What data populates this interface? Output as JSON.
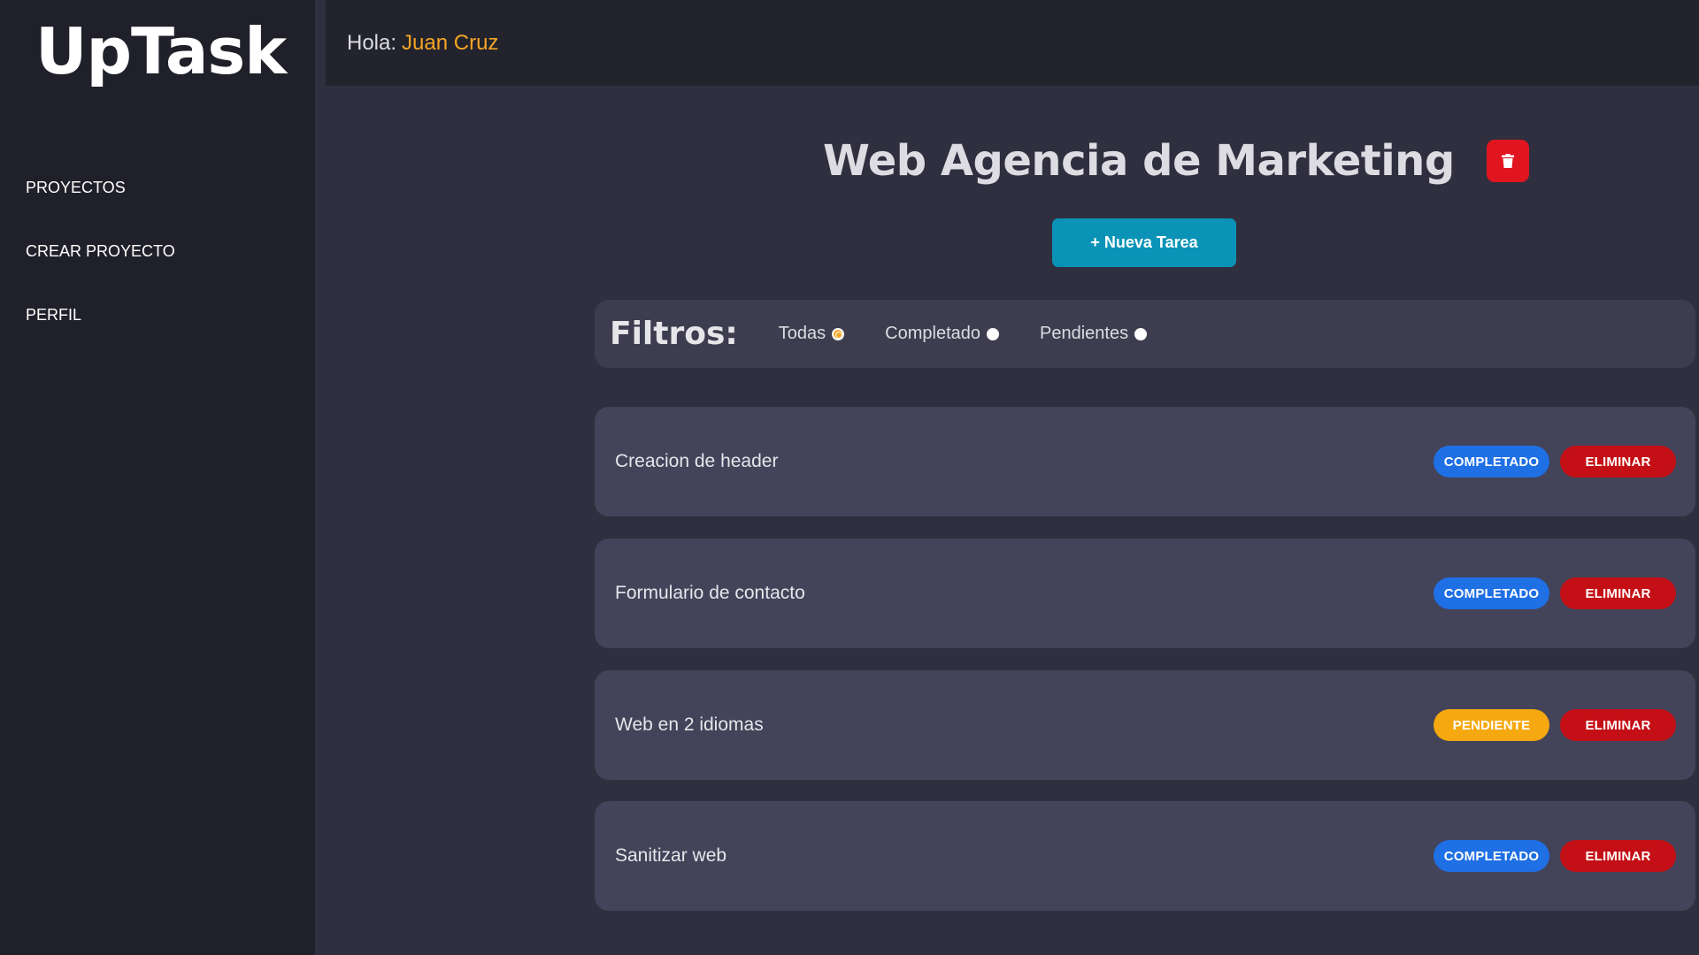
{
  "app": {
    "logo": "UpTask"
  },
  "sidebar": {
    "items": [
      {
        "label": "PROYECTOS"
      },
      {
        "label": "CREAR PROYECTO"
      },
      {
        "label": "PERFIL"
      }
    ]
  },
  "topbar": {
    "greeting": "Hola:",
    "user_name": "Juan Cruz"
  },
  "project": {
    "title": "Web Agencia de Marketing",
    "delete_icon": "trash-icon",
    "new_task_label": "+ Nueva Tarea"
  },
  "filters": {
    "title": "Filtros:",
    "options": [
      {
        "label": "Todas",
        "checked": true
      },
      {
        "label": "Completado",
        "checked": false
      },
      {
        "label": "Pendientes",
        "checked": false
      }
    ]
  },
  "tasks": [
    {
      "name": "Creacion de header",
      "status": "COMPLETADO",
      "delete": "ELIMINAR"
    },
    {
      "name": "Formulario de contacto",
      "status": "COMPLETADO",
      "delete": "ELIMINAR"
    },
    {
      "name": "Web en 2 idiomas",
      "status": "PENDIENTE",
      "delete": "ELIMINAR"
    },
    {
      "name": "Sanitizar web",
      "status": "COMPLETADO",
      "delete": "ELIMINAR"
    }
  ],
  "colors": {
    "accent": "#f5a623",
    "completed": "#1f6fe5",
    "pending": "#f5a80f",
    "danger": "#c30f15",
    "primary_button": "#0b93b7"
  }
}
